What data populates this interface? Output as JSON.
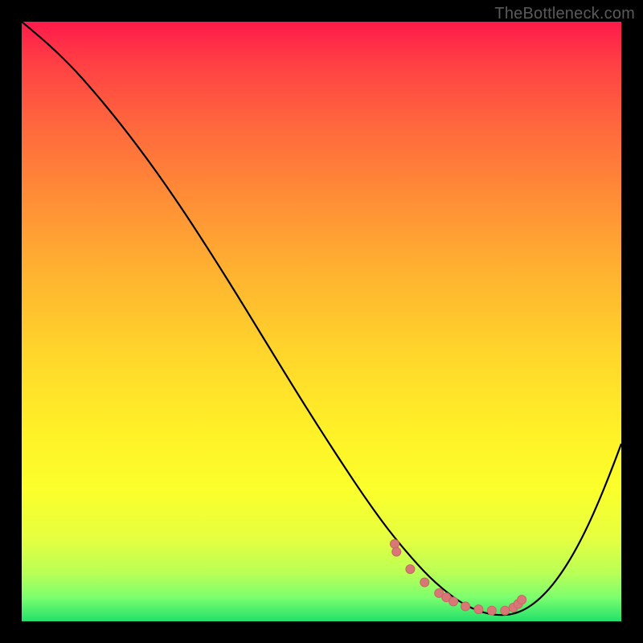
{
  "watermark": "TheBottleneck.com",
  "colors": {
    "curve": "#000000",
    "marker_fill": "#d97777",
    "marker_stroke": "#c96666"
  },
  "chart_data": {
    "type": "line",
    "title": "",
    "xlabel": "",
    "ylabel": "",
    "xlim": [
      0,
      100
    ],
    "ylim": [
      0,
      100
    ],
    "x": [
      0,
      3,
      6,
      9,
      12,
      15,
      18,
      21,
      24,
      27,
      30,
      33,
      36,
      39,
      42,
      45,
      48,
      51,
      54,
      57,
      60,
      62,
      64,
      66,
      68,
      70,
      72,
      74,
      76,
      78,
      80,
      82,
      84,
      86,
      88,
      90,
      92,
      94,
      96,
      98,
      100
    ],
    "y": [
      100,
      97.5,
      94.8,
      91.8,
      88.4,
      84.8,
      81.0,
      77.0,
      72.8,
      68.4,
      63.8,
      59.1,
      54.3,
      49.4,
      44.5,
      39.6,
      34.8,
      30.1,
      25.5,
      21.0,
      16.8,
      14.2,
      11.8,
      9.5,
      7.4,
      5.6,
      4.0,
      2.7,
      1.8,
      1.2,
      1.0,
      1.2,
      2.0,
      3.4,
      5.4,
      8.0,
      11.2,
      15.0,
      19.4,
      24.3,
      29.6
    ],
    "markers": {
      "x": [
        62.2,
        62.5,
        64.8,
        67.2,
        69.6,
        70.8,
        72.0,
        74.0,
        76.2,
        78.4,
        80.6,
        82.0,
        82.8,
        83.4
      ],
      "y": [
        12.9,
        11.6,
        8.7,
        6.5,
        4.7,
        4.0,
        3.3,
        2.5,
        2.0,
        1.8,
        1.8,
        2.3,
        2.9,
        3.6
      ]
    }
  }
}
